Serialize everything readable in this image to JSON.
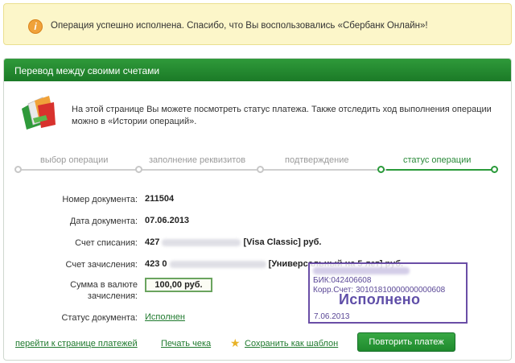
{
  "notice": {
    "icon": "info-icon",
    "icon_glyph": "i",
    "text": "Операция успешно исполнена. Спасибо, что Вы воспользовались «Сбербанк Онлайн»!"
  },
  "panel": {
    "title": "Перевод между своими счетами",
    "intro": "На этой странице Вы можете посмотреть статус платежа. Также отследить ход выполнения операции можно в «Истории операций»."
  },
  "steps": [
    {
      "label": "выбор операции",
      "active": false
    },
    {
      "label": "заполнение реквизитов",
      "active": false
    },
    {
      "label": "подтверждение",
      "active": false
    },
    {
      "label": "статус операции",
      "active": true
    }
  ],
  "fields": {
    "doc_number": {
      "label": "Номер документа:",
      "value": "211504"
    },
    "doc_date": {
      "label": "Дата документа:",
      "value": "07.06.2013"
    },
    "debit_account": {
      "label": "Счет списания:",
      "value_prefix": "427",
      "card_type": "[Visa Classic]",
      "currency": "руб."
    },
    "credit_account": {
      "label": "Счет зачисления:",
      "value_prefix": "423 0",
      "card_type": "[Универсальный на 5 лет]",
      "currency": "руб."
    },
    "amount": {
      "label": "Сумма в валюте зачисления:",
      "value": "100,00 руб."
    },
    "status": {
      "label": "Статус документа:",
      "value": "Исполнен"
    }
  },
  "stamp": {
    "bik": "БИК:042406608",
    "korr": "Корр.Счет: 30101810000000000608",
    "status": "Исполнено",
    "date": "7.06.2013"
  },
  "footer": {
    "payments_link": "перейти к странице платежей",
    "print_link": "Печать чека",
    "save_template_link": "Сохранить как шаблон",
    "repeat_button": "Повторить платеж"
  },
  "colors": {
    "header_green": "#1b7a27",
    "accent_green": "#2a9a3a",
    "notice_bg": "#fcf6c9",
    "stamp_purple": "#5f4ea8"
  }
}
